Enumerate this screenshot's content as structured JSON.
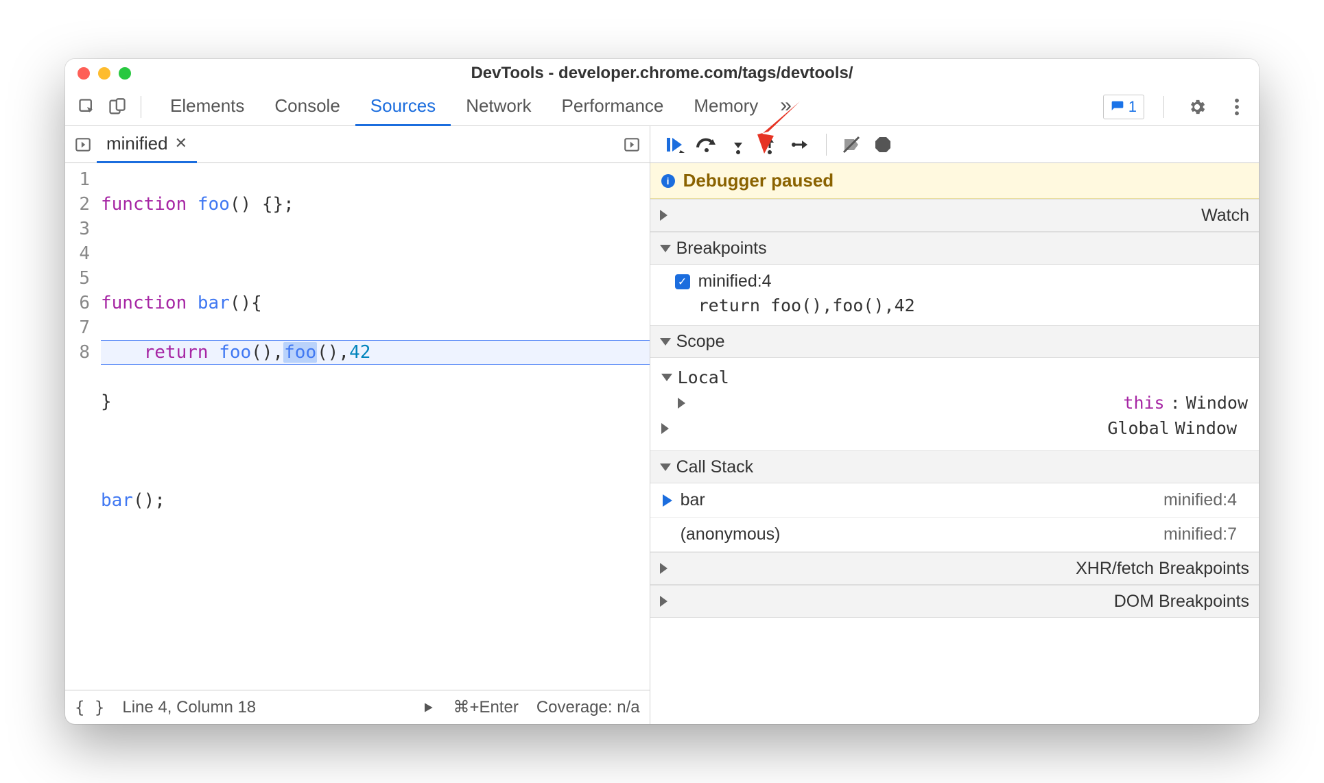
{
  "title": "DevTools - developer.chrome.com/tags/devtools/",
  "tabs": [
    "Elements",
    "Console",
    "Sources",
    "Network",
    "Performance",
    "Memory"
  ],
  "activeTab": "Sources",
  "issuesCount": "1",
  "file": {
    "name": "minified"
  },
  "code": {
    "lines": [
      "1",
      "2",
      "3",
      "4",
      "5",
      "6",
      "7",
      "8"
    ],
    "l1_kw": "function",
    "l1_fn": "foo",
    "l1_rest": "() {};",
    "l3_kw": "function",
    "l3_fn": "bar",
    "l3_rest": "(){",
    "l4_indent": "    ",
    "l4_kw": "return",
    "l4_sp": " ",
    "l4_f1": "foo",
    "l4_a1": "(),",
    "l4_f2": "foo",
    "l4_a2": "(),",
    "l4_num": "42",
    "l5": "}",
    "l7_fn": "bar",
    "l7_rest": "();"
  },
  "status": {
    "lineCol": "Line 4, Column 18",
    "runHint": "⌘+Enter",
    "coverage": "Coverage: n/a"
  },
  "paused": "Debugger paused",
  "panels": {
    "watch": "Watch",
    "breakpoints": "Breakpoints",
    "scope": "Scope",
    "callstack": "Call Stack",
    "xhr": "XHR/fetch Breakpoints",
    "dom": "DOM Breakpoints"
  },
  "breakpoint": {
    "label": "minified:4",
    "code": "return foo(),foo(),42"
  },
  "scope": {
    "local": "Local",
    "thisKey": "this",
    "thisVal": "Window",
    "global": "Global",
    "globalVal": "Window"
  },
  "callstack": [
    {
      "fn": "bar",
      "loc": "minified:4",
      "active": true
    },
    {
      "fn": "(anonymous)",
      "loc": "minified:7",
      "active": false
    }
  ],
  "moreGlyph": "»",
  "colon": ": "
}
